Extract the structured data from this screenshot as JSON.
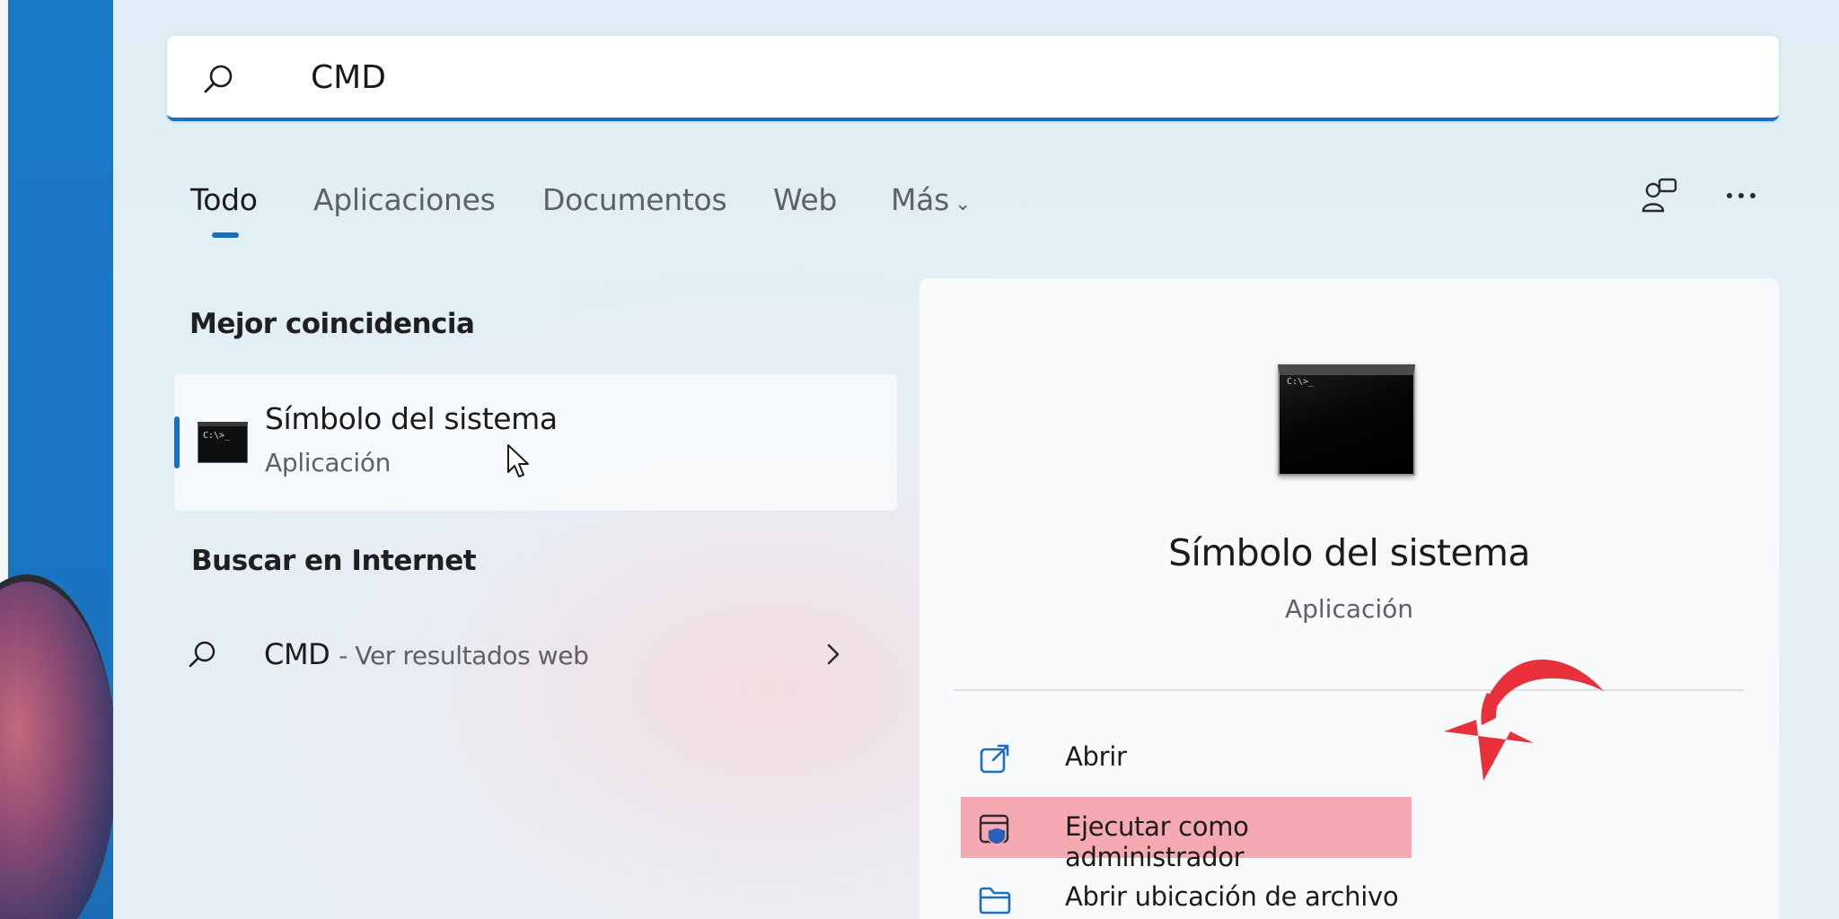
{
  "search": {
    "query": "CMD"
  },
  "tabs": [
    {
      "label": "Todo",
      "active": true
    },
    {
      "label": "Aplicaciones",
      "active": false
    },
    {
      "label": "Documentos",
      "active": false
    },
    {
      "label": "Web",
      "active": false
    },
    {
      "label": "Más",
      "active": false
    }
  ],
  "toolbar": {
    "account_icon": "account-switch-icon",
    "more_icon": "more-options-icon"
  },
  "best_match": {
    "header": "Mejor coincidencia",
    "name": "Símbolo del sistema",
    "type": "Aplicación",
    "icon_text": "C:\\>_"
  },
  "web_search": {
    "header": "Buscar en Internet",
    "query": "CMD",
    "suffix": "- Ver resultados web"
  },
  "detail": {
    "title": "Símbolo del sistema",
    "subtitle": "Aplicación",
    "actions": [
      {
        "label": "Abrir",
        "icon": "open-external-icon",
        "highlighted": false
      },
      {
        "label": "Ejecutar como administrador",
        "icon": "run-as-admin-icon",
        "highlighted": true
      },
      {
        "label": "Abrir ubicación de archivo",
        "icon": "folder-icon",
        "highlighted": false
      }
    ]
  },
  "colors": {
    "accent": "#1a6fc0",
    "highlight": "#f5a9b2",
    "annotation_arrow": "#e8313a"
  }
}
